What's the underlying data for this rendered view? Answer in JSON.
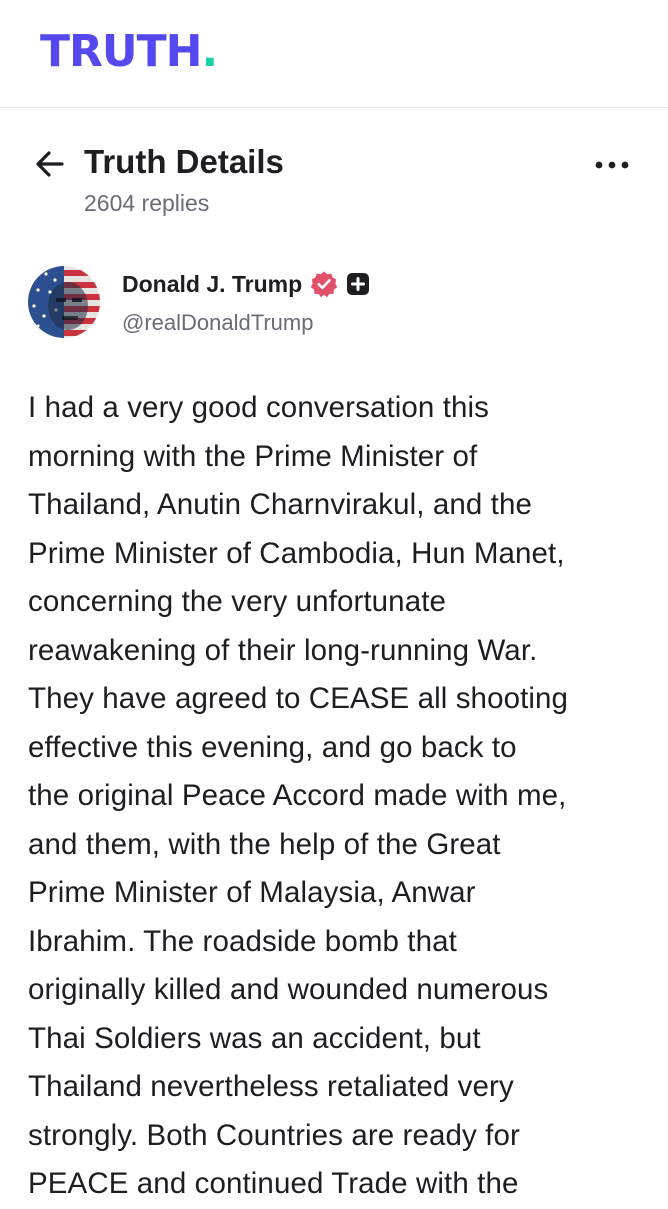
{
  "brand": {
    "logo_text": "TRUTH",
    "logo_dot": ".",
    "primary_color": "#5448ee",
    "accent_color": "#18d3a8"
  },
  "header": {
    "back_icon": "arrow-left-icon",
    "title": "Truth Details",
    "replies": "2604 replies",
    "more_icon": "more-horizontal-icon"
  },
  "author": {
    "display_name": "Donald J. Trump",
    "handle": "@realDonaldTrump",
    "verified_color": "#e2506c",
    "badges": [
      "verified-badge-icon",
      "plus-badge-icon"
    ]
  },
  "post": {
    "lines": [
      "I had a very good conversation this",
      "morning with the Prime Minister of",
      "Thailand, Anutin Charnvirakul, and the",
      "Prime Minister of Cambodia, Hun Manet,",
      "concerning the very unfortunate",
      "reawakening of their long-running War.",
      "They have agreed to CEASE all shooting",
      "effective this evening, and go back to",
      "the original Peace Accord made with me,",
      "and them, with the help of the Great",
      "Prime Minister of Malaysia, Anwar",
      "Ibrahim. The roadside bomb that",
      "originally killed and wounded numerous",
      "Thai Soldiers was an accident, but",
      "Thailand nevertheless retaliated very",
      "strongly. Both Countries are ready for",
      "PEACE and continued Trade with the"
    ]
  }
}
